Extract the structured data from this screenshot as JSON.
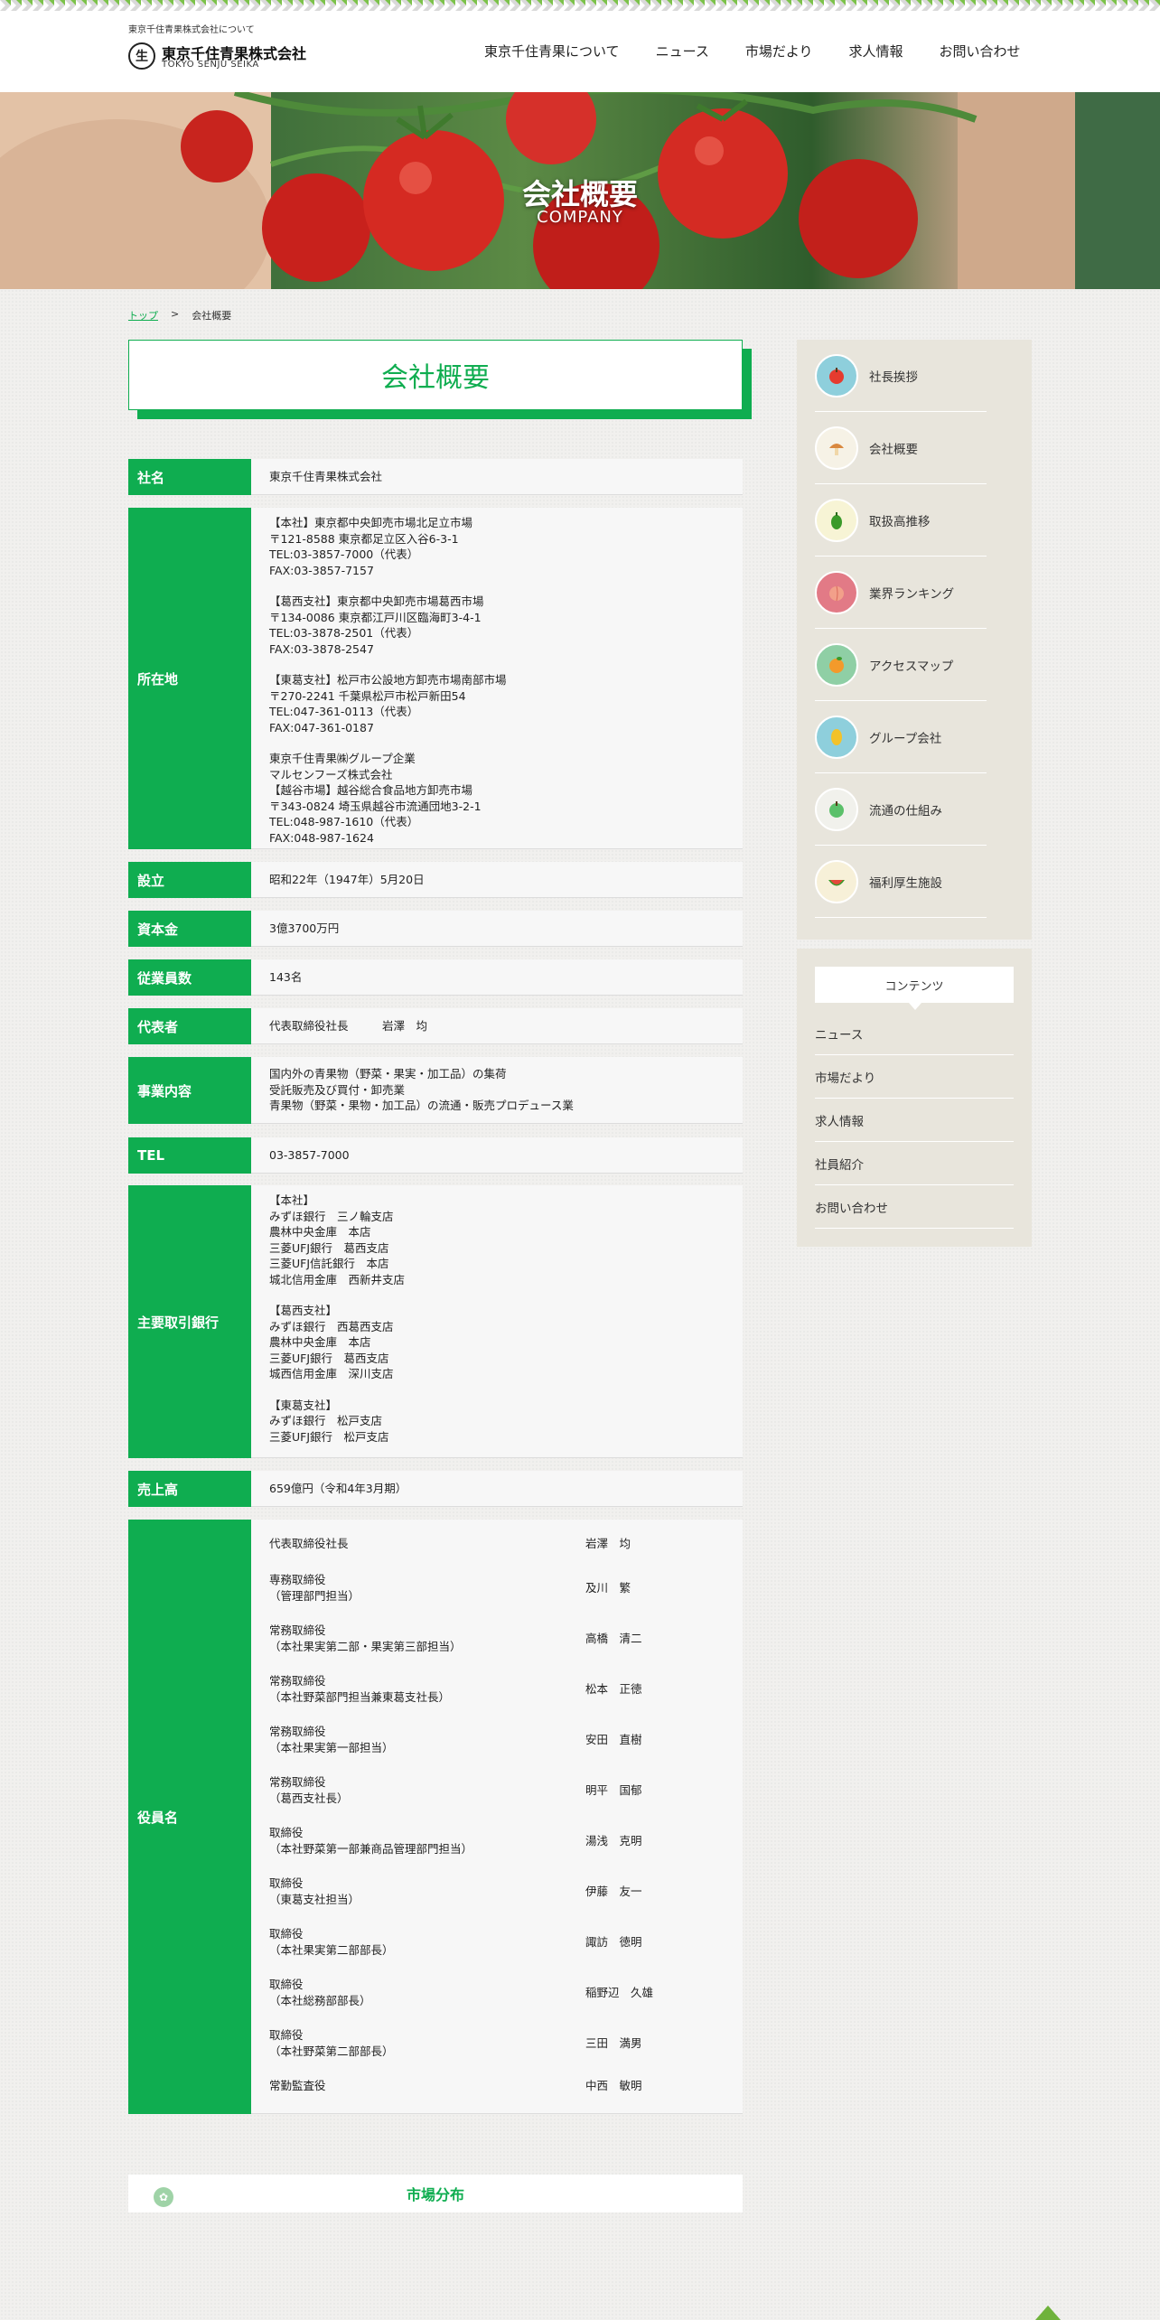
{
  "header": {
    "small_text": "東京千住青果株式会社について",
    "logo_mark": "生",
    "company_name": "東京千住青果株式会社",
    "company_en": "TOKYO SENJU SEIKA",
    "nav": [
      "東京千住青果について",
      "ニュース",
      "市場だより",
      "求人情報",
      "お問い合わせ"
    ]
  },
  "hero": {
    "title": "会社概要",
    "subtitle": "COMPANY"
  },
  "breadcrumb": {
    "home": "トップ",
    "sep": ">",
    "current": "会社概要"
  },
  "page_title": "会社概要",
  "rows": {
    "name": {
      "label": "社名",
      "value": "東京千住青果株式会社"
    },
    "address": {
      "label": "所在地",
      "paras": [
        [
          "【本社】東京都中央卸売市場北足立市場",
          "〒121-8588 東京都足立区入谷6-3-1",
          "TEL:03-3857-7000（代表）",
          "FAX:03-3857-7157"
        ],
        [
          "【葛西支社】東京都中央卸売市場葛西市場",
          "〒134-0086 東京都江戸川区臨海町3-4-1",
          "TEL:03-3878-2501（代表）",
          "FAX:03-3878-2547"
        ],
        [
          "【東葛支社】松戸市公設地方卸売市場南部市場",
          "〒270-2241 千葉県松戸市松戸新田54",
          "TEL:047-361-0113（代表）",
          "FAX:047-361-0187"
        ],
        [
          "東京千住青果㈱グループ企業",
          "マルセンフーズ株式会社",
          "【越谷市場】越谷総合食品地方卸売市場",
          "〒343-0824 埼玉県越谷市流通団地3-2-1",
          "TEL:048-987-1610（代表）",
          "FAX:048-987-1624"
        ]
      ]
    },
    "founded": {
      "label": "設立",
      "value": "昭和22年（1947年）5月20日"
    },
    "capital": {
      "label": "資本金",
      "value": "3億3700万円"
    },
    "employees": {
      "label": "従業員数",
      "value": "143名"
    },
    "representative": {
      "label": "代表者",
      "value": "代表取締役社長　　　岩澤　均"
    },
    "business": {
      "label": "事業内容",
      "lines": [
        "国内外の青果物（野菜・果実・加工品）の集荷",
        "受託販売及び買付・卸売業",
        "青果物（野菜・果物・加工品）の流通・販売プロデュース業"
      ]
    },
    "tel": {
      "label": "TEL",
      "value": "03-3857-7000"
    },
    "banks": {
      "label": "主要取引銀行",
      "paras": [
        [
          "【本社】",
          "みずほ銀行　三ノ輪支店",
          "農林中央金庫　本店",
          "三菱UFJ銀行　葛西支店",
          "三菱UFJ信託銀行　本店",
          "城北信用金庫　西新井支店"
        ],
        [
          "【葛西支社】",
          "みずほ銀行　西葛西支店",
          "農林中央金庫　本店",
          "三菱UFJ銀行　葛西支店",
          "城西信用金庫　深川支店"
        ],
        [
          "【東葛支社】",
          "みずほ銀行　松戸支店",
          "三菱UFJ銀行　松戸支店"
        ]
      ]
    },
    "sales": {
      "label": "売上高",
      "value": "659億円（令和4年3月期）"
    },
    "officers": {
      "label": "役員名",
      "list": [
        {
          "title": [
            "代表取締役社長"
          ],
          "name": "岩澤　均"
        },
        {
          "title": [
            "専務取締役",
            "（管理部門担当）"
          ],
          "name": "及川　繁"
        },
        {
          "title": [
            "常務取締役",
            "（本社果実第二部・果実第三部担当）"
          ],
          "name": "高橋　清二"
        },
        {
          "title": [
            "常務取締役",
            "（本社野菜部門担当兼東葛支社長）"
          ],
          "name": "松本　正徳"
        },
        {
          "title": [
            "常務取締役",
            "（本社果実第一部担当）"
          ],
          "name": "安田　直樹"
        },
        {
          "title": [
            "常務取締役",
            "（葛西支社長）"
          ],
          "name": "明平　国郁"
        },
        {
          "title": [
            "取締役",
            "（本社野菜第一部兼商品管理部門担当）"
          ],
          "name": "湯浅　克明"
        },
        {
          "title": [
            "取締役",
            "（東葛支社担当）"
          ],
          "name": "伊藤　友一"
        },
        {
          "title": [
            "取締役",
            "（本社果実第二部部長）"
          ],
          "name": "諏訪　徳明"
        },
        {
          "title": [
            "取締役",
            "（本社総務部部長）"
          ],
          "name": "稲野辺　久雄"
        },
        {
          "title": [
            "取締役",
            "（本社野菜第二部部長）"
          ],
          "name": "三田　満男"
        },
        {
          "title": [
            "常勤監査役"
          ],
          "name": "中西　敏明"
        }
      ]
    }
  },
  "market": {
    "title": "市場分布"
  },
  "sidebar": {
    "items": [
      {
        "label": "社長挨拶",
        "icon": "apple-icon",
        "bg": "#8ecfdc",
        "glyph": "#e53b2f"
      },
      {
        "label": "会社概要",
        "icon": "mushroom-icon",
        "bg": "#f6f2e6",
        "glyph": "#d9883e"
      },
      {
        "label": "取扱高推移",
        "icon": "pepper-icon",
        "bg": "#f7f4d5",
        "glyph": "#3a9a2a"
      },
      {
        "label": "業界ランキング",
        "icon": "peach-icon",
        "bg": "#e27a86",
        "glyph": "#f2a08a"
      },
      {
        "label": "アクセスマップ",
        "icon": "orange-icon",
        "bg": "#8fcfa5",
        "glyph": "#f39a2b"
      },
      {
        "label": "グループ会社",
        "icon": "mango-icon",
        "bg": "#8ecfdc",
        "glyph": "#f3c22a"
      },
      {
        "label": "流通の仕組み",
        "icon": "green-apple-icon",
        "bg": "#f1f1ec",
        "glyph": "#5bc06a"
      },
      {
        "label": "福利厚生施設",
        "icon": "watermelon-icon",
        "bg": "#f7f0d8",
        "glyph": "#e34a3a"
      }
    ],
    "contents_title": "コンテンツ",
    "contents": [
      "ニュース",
      "市場だより",
      "求人情報",
      "社員紹介",
      "お問い合わせ"
    ]
  }
}
